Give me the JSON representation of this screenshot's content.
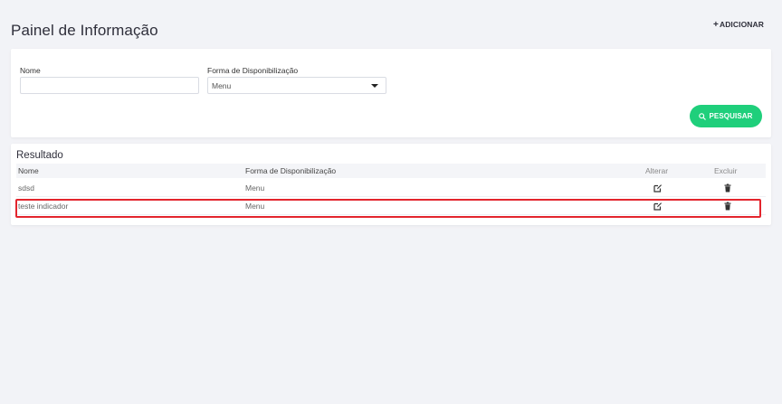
{
  "header": {
    "title": "Painel de Informação",
    "add_label": "ADICIONAR",
    "add_icon": "plus-icon"
  },
  "filters": {
    "name_label": "Nome",
    "name_value": "",
    "forma_label": "Forma de Disponibilização",
    "forma_value": "Menu",
    "search_label": "PESQUISAR",
    "search_icon": "search-icon"
  },
  "results": {
    "title": "Resultado",
    "columns": [
      "Nome",
      "Forma de Disponibilização",
      "Alterar",
      "Excluir"
    ],
    "rows": [
      {
        "nome": "sdsd",
        "forma": "Menu"
      },
      {
        "nome": "teste indicador",
        "forma": "Menu",
        "highlighted": true
      }
    ],
    "edit_icon": "edit-icon",
    "delete_icon": "trash-icon"
  },
  "colors": {
    "search_button": "#1fcf7b",
    "highlight_border": "#e3252d",
    "background": "#f2f3f7"
  }
}
